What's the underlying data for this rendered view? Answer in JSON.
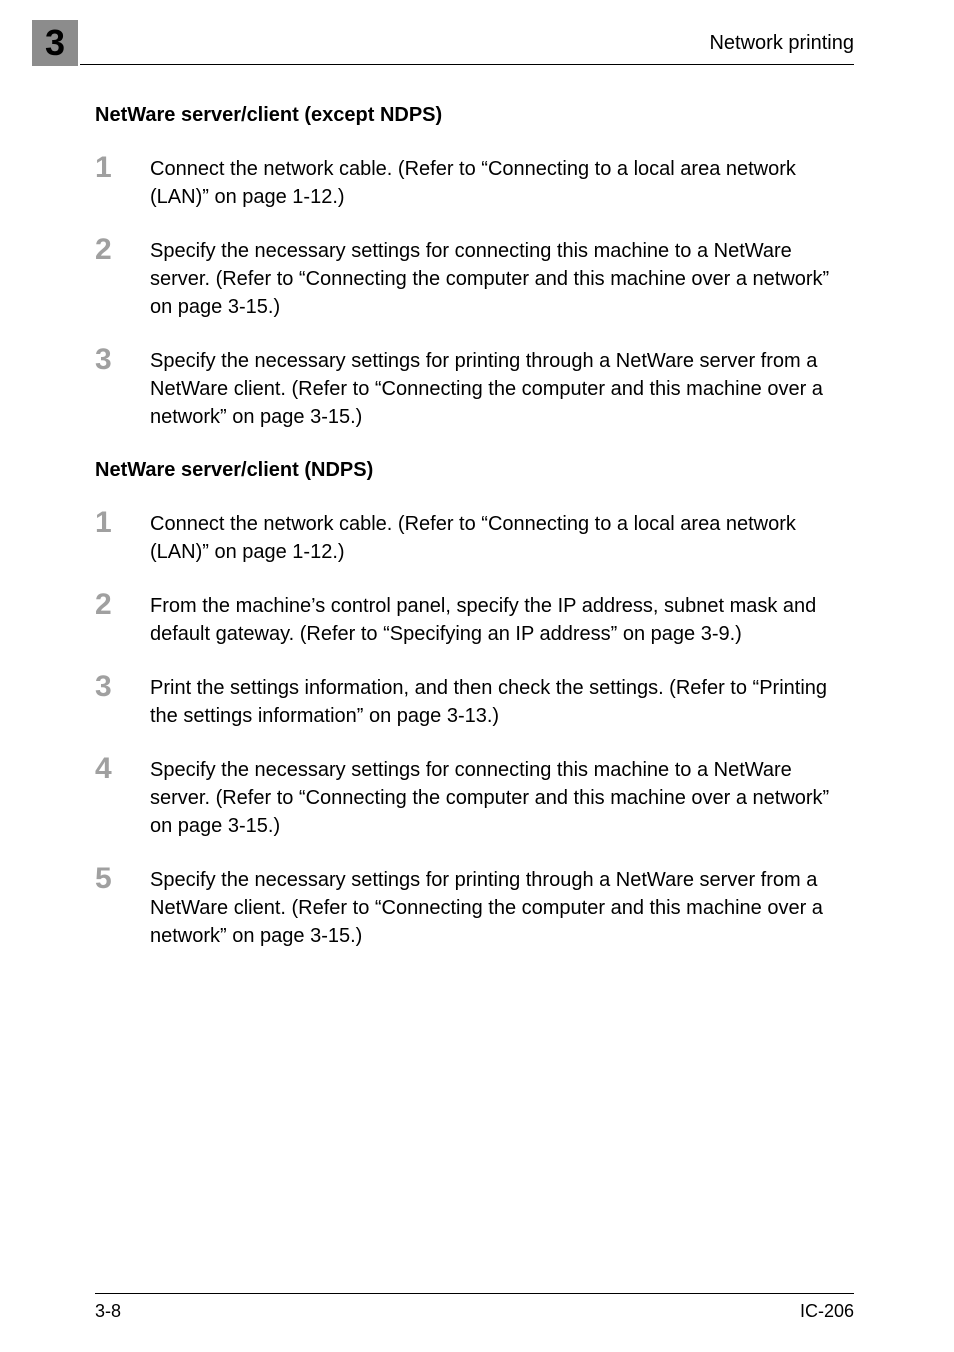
{
  "chapter": {
    "number": "3"
  },
  "header": {
    "title": "Network printing"
  },
  "sections": [
    {
      "heading": "NetWare server/client (except NDPS)",
      "steps": [
        "Connect the network cable. (Refer to “Connecting to a local area network (LAN)” on page 1-12.)",
        "Specify the necessary settings for connecting this machine to a NetWare server. (Refer to “Connecting the computer and this machine over a network” on page 3-15.)",
        "Specify the necessary settings for printing through a NetWare server from a NetWare client. (Refer to “Connecting the computer and this machine over a network” on page 3-15.)"
      ]
    },
    {
      "heading": "NetWare server/client (NDPS)",
      "steps": [
        "Connect the network cable. (Refer to “Connecting to a local area network (LAN)” on page 1-12.)",
        "From the machine’s control panel, specify the IP address, subnet mask and default gateway. (Refer to “Specifying an IP address” on page 3-9.)",
        "Print the settings information, and then check the settings. (Refer to “Printing the settings information” on page 3-13.)",
        "Specify the necessary settings for connecting this machine to a NetWare server. (Refer to “Connecting the computer and this machine over a network” on page 3-15.)",
        "Specify the necessary settings for printing through a NetWare server from a NetWare client. (Refer to “Connecting the computer and this machine over a network” on page 3-15.)"
      ]
    }
  ],
  "footer": {
    "left": "3-8",
    "right": "IC-206"
  },
  "step_numbers": [
    "1",
    "2",
    "3",
    "4",
    "5"
  ]
}
